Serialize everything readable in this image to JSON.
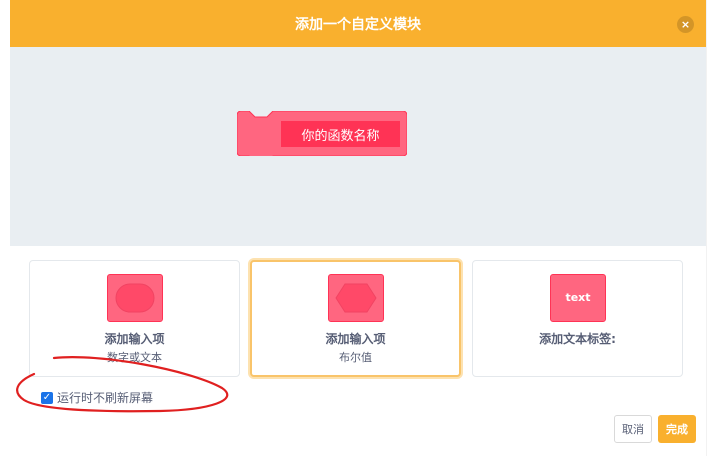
{
  "dialog": {
    "title": "添加一个自定义模块",
    "close_glyph": "×"
  },
  "block": {
    "label": "你的函数名称",
    "color": "#ff6680"
  },
  "options": [
    {
      "title": "添加输入项",
      "subtitle": "数字或文本",
      "icon": "round-input-icon"
    },
    {
      "title": "添加输入项",
      "subtitle": "布尔值",
      "icon": "boolean-input-icon"
    },
    {
      "title": "添加文本标签:",
      "subtitle": "",
      "icon": "text-label-icon",
      "icon_text": "text"
    }
  ],
  "run_without_refresh": {
    "label": "运行时不刷新屏幕",
    "checked": true
  },
  "buttons": {
    "cancel": "取消",
    "ok": "完成"
  },
  "colors": {
    "header": "#f9b02e",
    "workspace": "#e9eef2",
    "accent": "#ff3355"
  }
}
